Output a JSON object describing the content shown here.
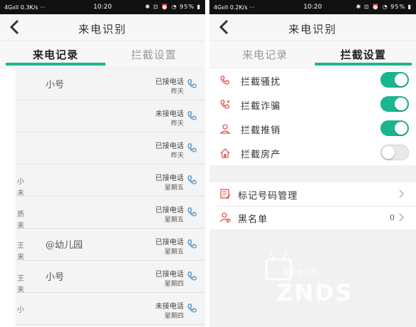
{
  "left": {
    "status": {
      "network": "4Gııll 0.3K/s ···",
      "time": "10:20",
      "battery": "95%"
    },
    "title": "来电识别",
    "tabs": [
      {
        "label": "来电记录",
        "active": true
      },
      {
        "label": "拦截设置",
        "active": false
      }
    ],
    "calls": [
      {
        "name": "小号",
        "status": "已接电话",
        "day": "昨天"
      },
      {
        "name": "",
        "status": "未接电话",
        "day": "昨天"
      },
      {
        "name": "",
        "status": "已接电话",
        "day": "昨天"
      },
      {
        "name": "",
        "status": "已接电话",
        "day": "星期五"
      },
      {
        "name": "",
        "status": "已接电话",
        "day": "星期五"
      },
      {
        "name": "@幼儿园",
        "status": "已接电话",
        "day": "星期五"
      },
      {
        "name": "小号",
        "status": "已接电话",
        "day": "星期四"
      },
      {
        "name": "",
        "status": "未接电话",
        "day": "星期四"
      }
    ],
    "side_chars": [
      "小",
      "未",
      "质",
      "来",
      "王",
      "来",
      "王",
      "来",
      "小"
    ]
  },
  "right": {
    "status": {
      "network": "4Gııll 0.2K/s ···",
      "time": "10:20",
      "battery": "95%"
    },
    "title": "来电识别",
    "tabs": [
      {
        "label": "来电记录",
        "active": false
      },
      {
        "label": "拦截设置",
        "active": true
      }
    ],
    "settings": [
      {
        "label": "拦截骚扰",
        "on": true,
        "icon": "phone-icon"
      },
      {
        "label": "拦截诈骗",
        "on": true,
        "icon": "phone-warning-icon"
      },
      {
        "label": "拦截推销",
        "on": true,
        "icon": "salesman-icon"
      },
      {
        "label": "拦截房产",
        "on": false,
        "icon": "house-icon"
      }
    ],
    "manage": [
      {
        "label": "标记号码管理",
        "count": "",
        "icon": "edit-list-icon"
      },
      {
        "label": "黑名单",
        "count": "0",
        "icon": "blacklist-user-icon"
      }
    ]
  },
  "colors": {
    "accent": "#1bb591",
    "icon_red": "#e05a4f",
    "phone_blue": "#4a90c8"
  },
  "watermark": {
    "text": "ZNDS",
    "sub": "智能电视网"
  }
}
